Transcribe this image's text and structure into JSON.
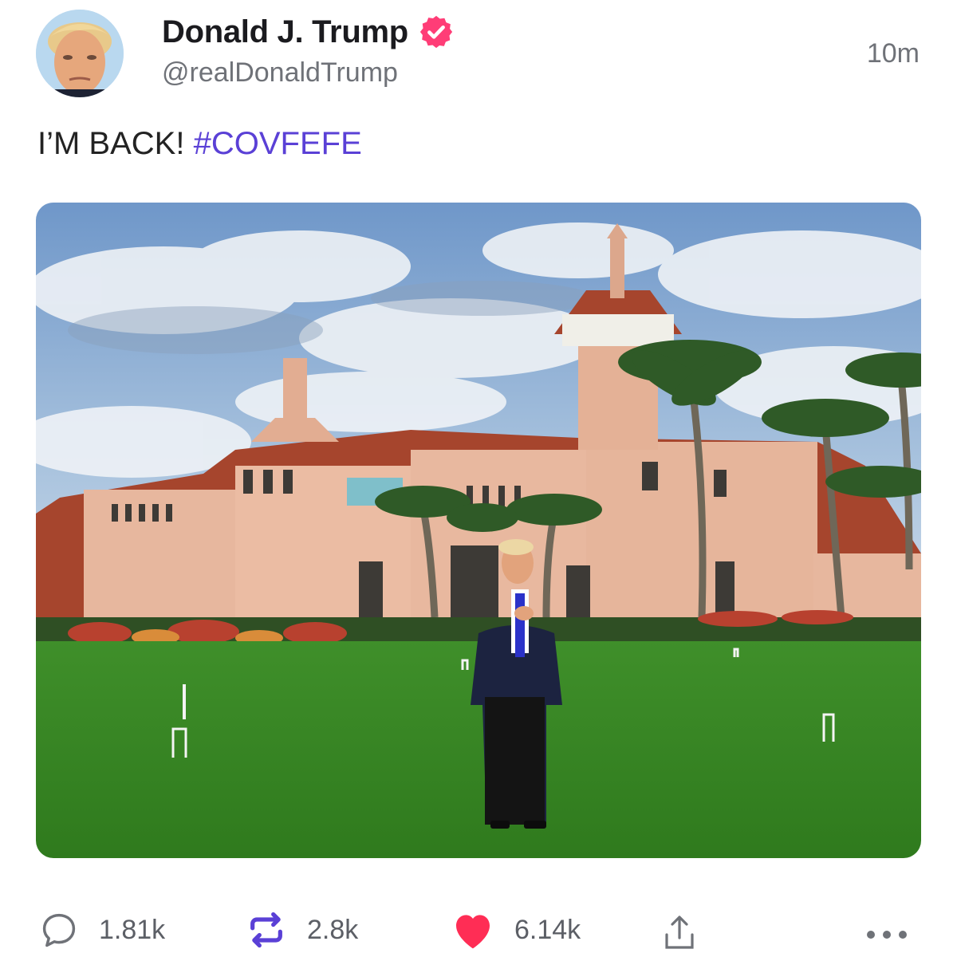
{
  "post": {
    "author": {
      "display_name": "Donald J. Trump",
      "handle": "@realDonaldTrump",
      "verified": true
    },
    "timestamp": "10m",
    "text": {
      "main": "I’M BACK!",
      "hashtag": "#COVFEFE"
    },
    "media": {
      "scene": "man in dark suit standing on lawn in front of pink mansion with tower and palm trees"
    },
    "actions": {
      "replies": "1.81k",
      "reposts": "2.8k",
      "likes": "6.14k"
    }
  },
  "colors": {
    "accent": "#5a40d6",
    "verified_badge": "#ff3d77",
    "like_heart": "#ff2d55",
    "secondary_text": "#6f7278"
  },
  "icons": [
    "verified-badge-icon",
    "reply-icon",
    "repost-icon",
    "like-icon",
    "share-icon",
    "more-icon"
  ]
}
